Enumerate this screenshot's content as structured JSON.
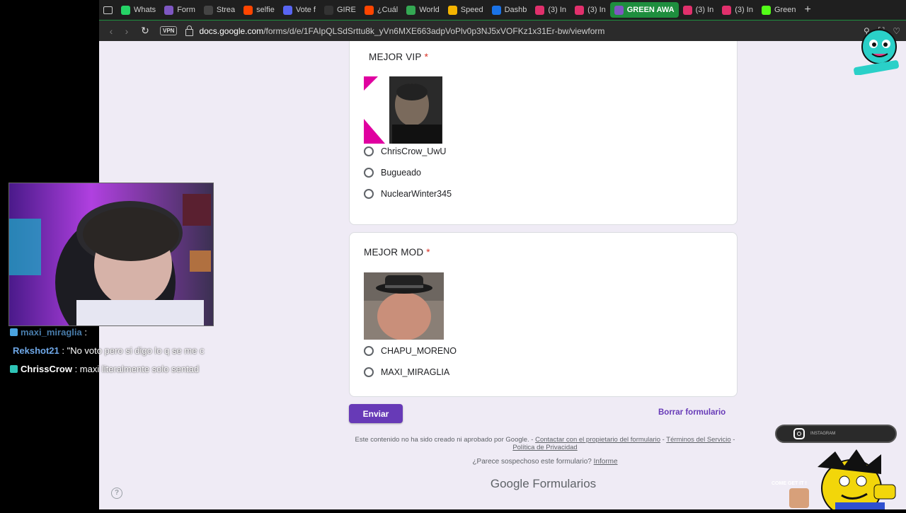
{
  "browser": {
    "tabs": [
      {
        "label": "Whats",
        "icon": "whatsapp-icon",
        "color": "#25d366"
      },
      {
        "label": "Form",
        "icon": "forms-icon",
        "color": "#7e57c2"
      },
      {
        "label": "Strea",
        "icon": "w-logo-icon",
        "color": "#444444"
      },
      {
        "label": "selfie",
        "icon": "reddit-icon",
        "color": "#ff4500"
      },
      {
        "label": "Vote f",
        "icon": "discord-icon",
        "color": "#5865f2"
      },
      {
        "label": "GIRE",
        "icon": "tiktok-icon",
        "color": "#333333"
      },
      {
        "label": "¿Cuál",
        "icon": "reddit-icon",
        "color": "#ff4500"
      },
      {
        "label": "World",
        "icon": "globe-icon",
        "color": "#34a853"
      },
      {
        "label": "Speed",
        "icon": "speed-icon",
        "color": "#f4b400"
      },
      {
        "label": "Dashb",
        "icon": "r-logo-icon",
        "color": "#1a73e8"
      },
      {
        "label": "(3) In",
        "icon": "instagram-icon",
        "color": "#e1306c"
      },
      {
        "label": "(3) In",
        "icon": "instagram-icon",
        "color": "#e1306c"
      },
      {
        "label": "GREEN AWA",
        "icon": "forms-icon",
        "color": "#7e57c2",
        "active": true
      },
      {
        "label": "(3) In",
        "icon": "instagram-icon",
        "color": "#e1306c"
      },
      {
        "label": "(3) In",
        "icon": "instagram-icon",
        "color": "#e1306c"
      },
      {
        "label": "Green",
        "icon": "kick-icon",
        "color": "#53fc18"
      }
    ],
    "vpn_label": "VPN",
    "url_domain": "docs.google.com",
    "url_path": "/forms/d/e/1FAIpQLSdSrttu8k_yVn6MXE663adpVoPlv0p3NJ5xVOFKz1x31Er-bw/viewform"
  },
  "form": {
    "q1": {
      "title": "MEJOR VIP",
      "required_mark": "*",
      "options": [
        "ChrisCrow_UwU",
        "Bugueado",
        "NuclearWinter345"
      ]
    },
    "q2": {
      "title": "MEJOR MOD",
      "required_mark": "*",
      "options": [
        "CHAPU_MORENO",
        "MAXI_MIRAGLIA"
      ]
    },
    "submit_label": "Enviar",
    "clear_label": "Borrar formulario",
    "disclaimer_text": "Este contenido no ha sido creado ni aprobado por Google. - ",
    "contact_link": "Contactar con el propietario del formulario",
    "dash": " - ",
    "terms_link": "Términos del Servicio",
    "privacy_link": "Política de Privacidad",
    "suspicious_text": "¿Parece sospechoso este formulario? ",
    "report_link": "Informe",
    "brand_google": "Google",
    "brand_forms": "Formularios"
  },
  "chat": [
    {
      "user": "maxi_miraglia",
      "message": " :",
      "color": "#5b9bd5",
      "badge": "#4aa3df"
    },
    {
      "user": "Rekshot21",
      "message": " : \"No voto pero si digo lo q se me c",
      "color": "#5b9bd5",
      "badge": ""
    },
    {
      "user": "ChrissCrow",
      "message": " : maxi literalmente solo sentad",
      "color": "#ffffff",
      "badge": "#2ec4b6"
    }
  ],
  "overlay": {
    "ig_text": "INSTAGRAM",
    "come_get_it": "COME GET IT !"
  },
  "colors": {
    "accent": "#673ab7",
    "page_bg": "#efebf5",
    "required": "#d93025",
    "active_tab": "#1e8e3e"
  }
}
